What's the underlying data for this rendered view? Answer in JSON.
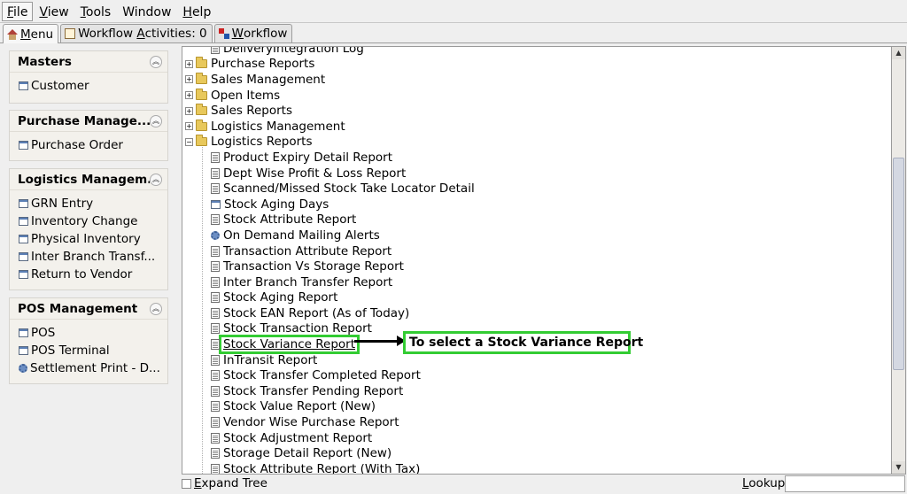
{
  "menubar": {
    "items": [
      {
        "pre": "",
        "key": "F",
        "post": "ile"
      },
      {
        "pre": "",
        "key": "V",
        "post": "iew"
      },
      {
        "pre": "",
        "key": "T",
        "post": "ools"
      },
      {
        "pre": "",
        "key": "",
        "post": "Window"
      },
      {
        "pre": "",
        "key": "H",
        "post": "elp"
      }
    ]
  },
  "tabs": {
    "menu": {
      "key": "M",
      "post": "enu"
    },
    "workflow_activities": {
      "pre": "Workflow ",
      "key": "A",
      "post": "ctivities: 0"
    },
    "workflow": {
      "key": "W",
      "post": "orkflow"
    }
  },
  "sidebar": {
    "groups": [
      {
        "title": "Masters",
        "items": [
          "Customer"
        ]
      },
      {
        "title": "Purchase Manage...",
        "items": [
          "Purchase Order"
        ]
      },
      {
        "title": "Logistics Managem...",
        "items": [
          "GRN Entry",
          "Inventory Change",
          "Physical Inventory",
          "Inter Branch Transf...",
          "Return to Vendor"
        ]
      },
      {
        "title": "POS Management",
        "items": [
          "POS",
          "POS Terminal",
          "Settlement Print - D..."
        ]
      }
    ]
  },
  "tree": {
    "partial_top": "DeliveryIntegration Log",
    "folders": [
      "Purchase Reports",
      "Sales Management",
      "Open Items",
      "Sales Reports",
      "Logistics Management",
      "Logistics Reports"
    ],
    "reports": [
      {
        "label": "Product Expiry Detail Report",
        "icon": "doc-icon"
      },
      {
        "label": "Dept Wise Profit & Loss Report",
        "icon": "doc-icon"
      },
      {
        "label": "Scanned/Missed Stock Take Locator Detail",
        "icon": "doc-icon"
      },
      {
        "label": "Stock Aging Days",
        "icon": "window-icon"
      },
      {
        "label": "Stock Attribute Report",
        "icon": "doc-icon"
      },
      {
        "label": "On Demand Mailing Alerts",
        "icon": "gear-icon"
      },
      {
        "label": "Transaction Attribute Report",
        "icon": "doc-icon"
      },
      {
        "label": "Transaction Vs Storage Report",
        "icon": "doc-icon"
      },
      {
        "label": "Inter Branch Transfer Report",
        "icon": "doc-icon"
      },
      {
        "label": "Stock Aging Report",
        "icon": "doc-icon"
      },
      {
        "label": "Stock EAN Report (As of Today)",
        "icon": "doc-icon"
      },
      {
        "label": "Stock Transaction Report",
        "icon": "doc-icon"
      },
      {
        "label": "Stock Variance Report",
        "icon": "doc-icon"
      },
      {
        "label": "InTransit Report",
        "icon": "doc-icon"
      },
      {
        "label": "Stock Transfer Completed Report",
        "icon": "doc-icon"
      },
      {
        "label": "Stock Transfer Pending Report",
        "icon": "doc-icon"
      },
      {
        "label": "Stock Value Report (New)",
        "icon": "doc-icon"
      },
      {
        "label": "Vendor Wise Purchase Report",
        "icon": "doc-icon"
      },
      {
        "label": "Stock Adjustment Report",
        "icon": "doc-icon"
      },
      {
        "label": "Storage Detail Report (New)",
        "icon": "doc-icon"
      },
      {
        "label": "Stock Attribute Report (With Tax)",
        "icon": "doc-icon"
      }
    ],
    "selected": "Stock Variance Report"
  },
  "annotation": {
    "text": "To select a Stock Variance Report",
    "color": "#33cc33"
  },
  "bottom": {
    "expand_tree": {
      "key": "E",
      "post": "xpand Tree"
    },
    "lookup": {
      "key": "L",
      "post": "ookup"
    },
    "lookup_value": ""
  }
}
